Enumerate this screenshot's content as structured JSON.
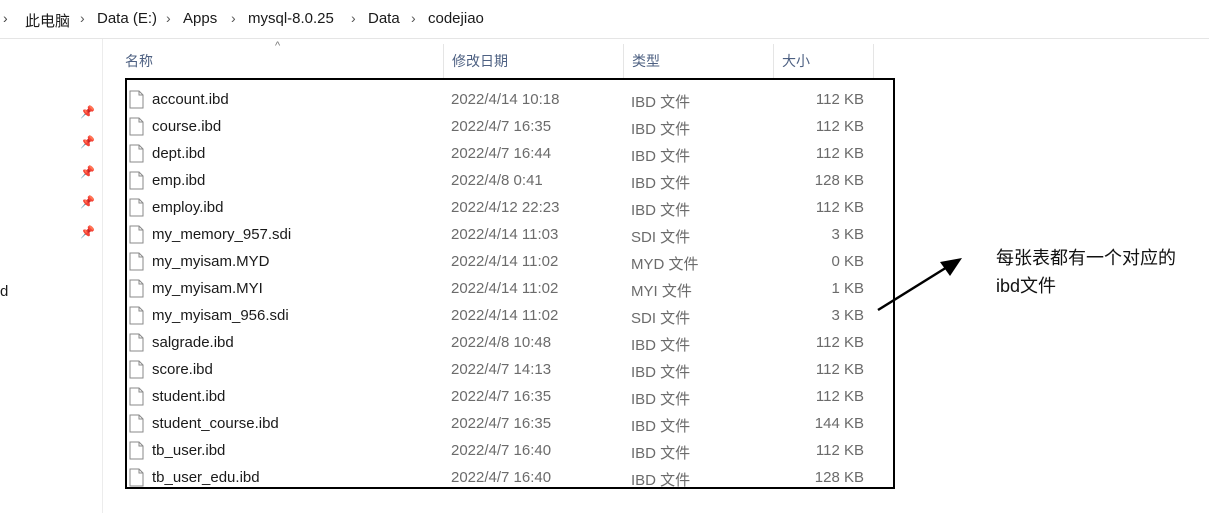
{
  "breadcrumb": {
    "items": [
      "此电脑",
      "Data (E:)",
      "Apps",
      "mysql-8.0.25",
      "Data",
      "codejiao"
    ]
  },
  "nav": {
    "fragment": "d"
  },
  "columns": {
    "name": "名称",
    "modified": "修改日期",
    "type": "类型",
    "size": "大小"
  },
  "files": [
    {
      "name": "account.ibd",
      "modified": "2022/4/14 10:18",
      "type": "IBD 文件",
      "size": "112 KB"
    },
    {
      "name": "course.ibd",
      "modified": "2022/4/7 16:35",
      "type": "IBD 文件",
      "size": "112 KB"
    },
    {
      "name": "dept.ibd",
      "modified": "2022/4/7 16:44",
      "type": "IBD 文件",
      "size": "112 KB"
    },
    {
      "name": "emp.ibd",
      "modified": "2022/4/8 0:41",
      "type": "IBD 文件",
      "size": "128 KB"
    },
    {
      "name": "employ.ibd",
      "modified": "2022/4/12 22:23",
      "type": "IBD 文件",
      "size": "112 KB"
    },
    {
      "name": "my_memory_957.sdi",
      "modified": "2022/4/14 11:03",
      "type": "SDI 文件",
      "size": "3 KB"
    },
    {
      "name": "my_myisam.MYD",
      "modified": "2022/4/14 11:02",
      "type": "MYD 文件",
      "size": "0 KB"
    },
    {
      "name": "my_myisam.MYI",
      "modified": "2022/4/14 11:02",
      "type": "MYI 文件",
      "size": "1 KB"
    },
    {
      "name": "my_myisam_956.sdi",
      "modified": "2022/4/14 11:02",
      "type": "SDI 文件",
      "size": "3 KB"
    },
    {
      "name": "salgrade.ibd",
      "modified": "2022/4/8 10:48",
      "type": "IBD 文件",
      "size": "112 KB"
    },
    {
      "name": "score.ibd",
      "modified": "2022/4/7 14:13",
      "type": "IBD 文件",
      "size": "112 KB"
    },
    {
      "name": "student.ibd",
      "modified": "2022/4/7 16:35",
      "type": "IBD 文件",
      "size": "112 KB"
    },
    {
      "name": "student_course.ibd",
      "modified": "2022/4/7 16:35",
      "type": "IBD 文件",
      "size": "144 KB"
    },
    {
      "name": "tb_user.ibd",
      "modified": "2022/4/7 16:40",
      "type": "IBD 文件",
      "size": "112 KB"
    },
    {
      "name": "tb_user_edu.ibd",
      "modified": "2022/4/7 16:40",
      "type": "IBD 文件",
      "size": "128 KB"
    }
  ],
  "annotation": {
    "line1": "每张表都有一个对应的",
    "line2": "ibd文件"
  },
  "colors": {
    "header_text": "#4d6082",
    "highlight_box": "#000000",
    "secondary_text": "#6b6b6b"
  },
  "icons": {
    "separator": "chevron-right-icon",
    "pin": "pin-icon",
    "file": "file-icon",
    "sort": "sort-up-icon"
  }
}
